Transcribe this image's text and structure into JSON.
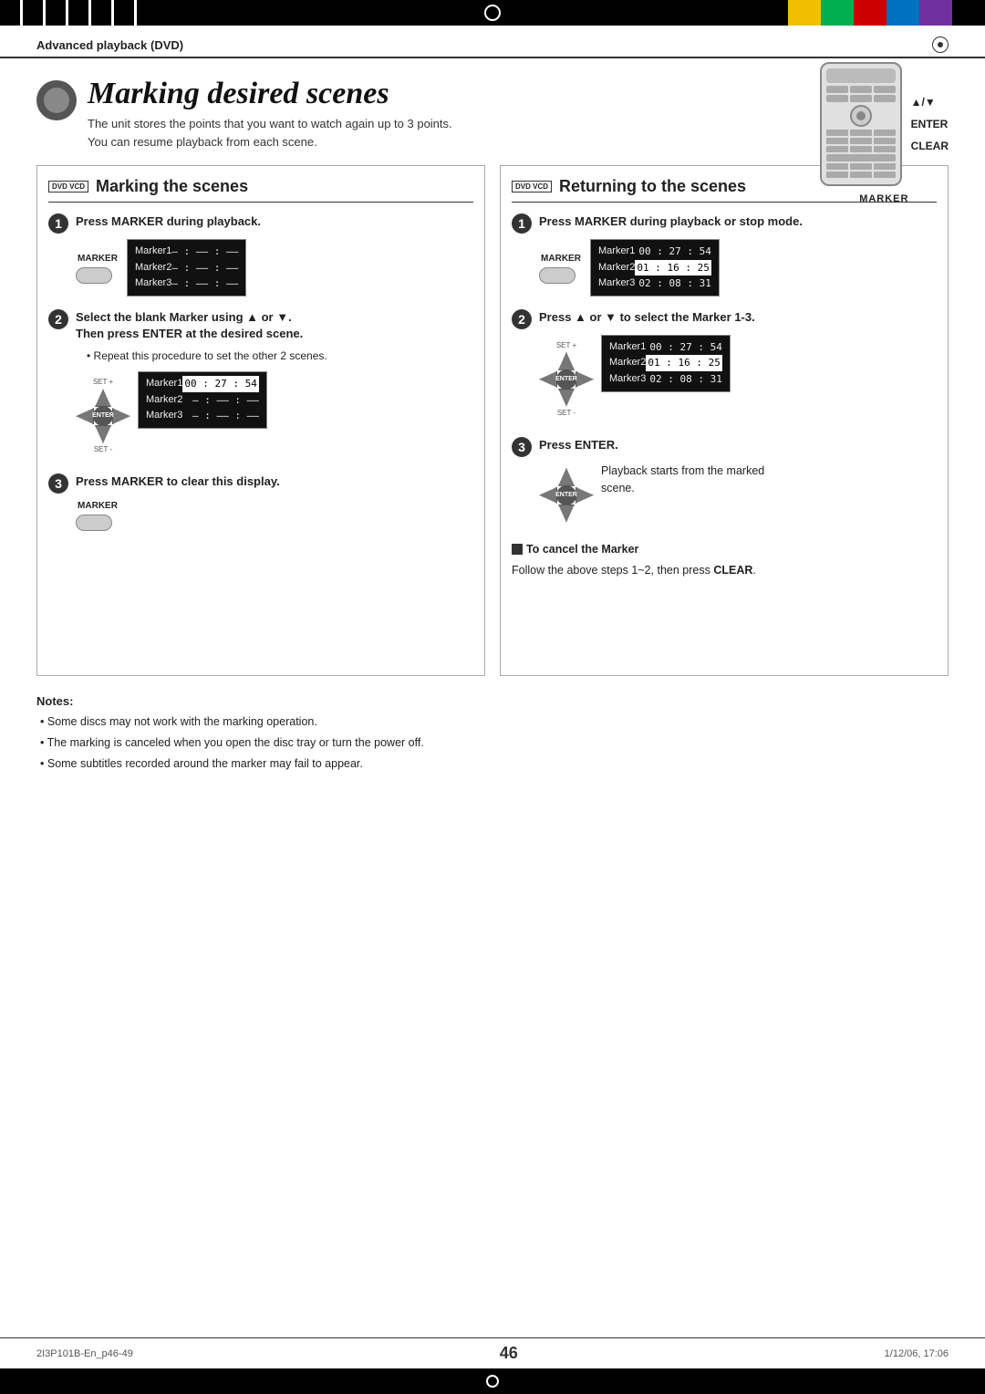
{
  "page": {
    "top_bar": {
      "left_stripes": [
        "#000",
        "#333",
        "#555",
        "#777",
        "#999"
      ],
      "right_colors": [
        "#f0c000",
        "#00b050",
        "#cc0000",
        "#0070c0",
        "#7030a0",
        "#000"
      ]
    },
    "header": {
      "breadcrumb": "Advanced playback (DVD)"
    },
    "title": "Marking desired scenes",
    "subtitle_line1": "The unit stores the points that you want to watch again up to 3 points.",
    "subtitle_line2": "You can resume playback from each scene.",
    "remote_labels": {
      "arrow": "▲/▼",
      "enter": "ENTER",
      "clear": "CLEAR",
      "marker": "MARKER"
    },
    "left_col": {
      "badge": "DVD VCD",
      "title": "Marking the scenes",
      "step1_title": "Press MARKER during playback.",
      "step2_title": "Select the blank Marker using ▲ or ▼.",
      "step2_sub": "Then press ENTER at the desired scene.",
      "step2_bullet": "Repeat this procedure to set the other 2 scenes.",
      "step3_title": "Press MARKER to clear this display.",
      "markers_step1": [
        {
          "label": "Marker1",
          "value": "— : — — : — —"
        },
        {
          "label": "Marker2",
          "value": "— : — — : — —"
        },
        {
          "label": "Marker3",
          "value": "— : — — : — —"
        }
      ],
      "markers_step2": [
        {
          "label": "Marker1",
          "value": "00 : 27 : 54",
          "highlight": true
        },
        {
          "label": "Marker2",
          "value": "— : — — : — —"
        },
        {
          "label": "Marker3",
          "value": "— : — — : — —"
        }
      ]
    },
    "right_col": {
      "badge": "DVD VCD",
      "title": "Returning to the scenes",
      "step1_title": "Press MARKER during playback or stop mode.",
      "step2_title": "Press ▲ or ▼ to select the Marker 1-3.",
      "step3_title": "Press ENTER.",
      "step3_desc": "Playback starts from the marked scene.",
      "cancel_title": "To cancel the Marker",
      "cancel_desc": "Follow the above steps 1~2, then press CLEAR.",
      "markers_step1": [
        {
          "label": "Marker1",
          "value": "00 : 27 : 54"
        },
        {
          "label": "Marker2",
          "value": "01 : 16 : 25",
          "highlight": true
        },
        {
          "label": "Marker3",
          "value": "02 : 08 : 31"
        }
      ],
      "markers_step2": [
        {
          "label": "Marker1",
          "value": "00 : 27 : 54"
        },
        {
          "label": "Marker2",
          "value": "01 : 16 : 25",
          "highlight": true
        },
        {
          "label": "Marker3",
          "value": "02 : 08 : 31"
        }
      ]
    },
    "notes": {
      "title": "Notes:",
      "items": [
        "Some discs may not work with the marking operation.",
        "The marking is canceled when you open the disc tray or turn the power off.",
        "Some subtitles recorded around the marker may fail to appear."
      ]
    },
    "footer": {
      "left": "2I3P101B-En_p46-49",
      "center": "46",
      "right": "1/12/06, 17:06"
    }
  }
}
